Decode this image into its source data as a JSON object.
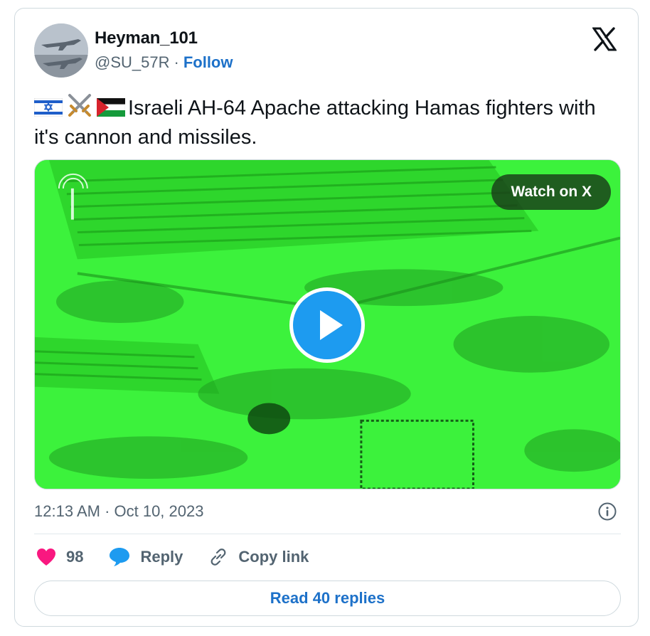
{
  "author": {
    "name": "Heyman_101",
    "handle": "@SU_57R",
    "separator": "·",
    "follow_label": "Follow"
  },
  "tweet": {
    "text": "Israeli AH-64 Apache attacking Hamas fighters with it's cannon and missiles.",
    "emojis": [
      "israel-flag",
      "crossed-swords",
      "palestine-flag"
    ]
  },
  "media": {
    "watch_label": "Watch on X",
    "tint_color": "#3cf23c"
  },
  "meta": {
    "timestamp": "12:13 AM · Oct 10, 2023"
  },
  "actions": {
    "like_count": "98",
    "reply_label": "Reply",
    "copy_label": "Copy link"
  },
  "read_replies_label": "Read 40 replies",
  "colors": {
    "link": "#1d71c9",
    "like": "#f91880",
    "reply": "#1d9bf0",
    "muted": "#536471"
  }
}
